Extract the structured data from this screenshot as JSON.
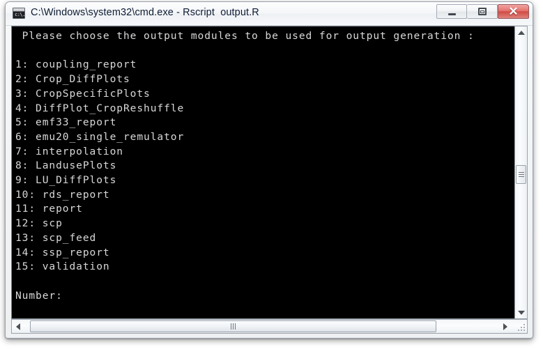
{
  "window": {
    "title": "C:\\Windows\\system32\\cmd.exe - Rscript  output.R",
    "icon": "cmd-console-icon",
    "icon_text": "c:\\.",
    "controls": {
      "minimize_label": "—",
      "maximize_label": "□",
      "close_label": "✕"
    }
  },
  "console": {
    "prompt_line": " Please choose the output modules to be used for output generation :",
    "blank_after_prompt": "",
    "menu": [
      {
        "number": "1:",
        "name": "coupling_report"
      },
      {
        "number": "2:",
        "name": "Crop_DiffPlots"
      },
      {
        "number": "3:",
        "name": "CropSpecificPlots"
      },
      {
        "number": "4:",
        "name": "DiffPlot_CropReshuffle"
      },
      {
        "number": "5:",
        "name": "emf33_report"
      },
      {
        "number": "6:",
        "name": "emu20_single_remulator"
      },
      {
        "number": "7:",
        "name": "interpolation"
      },
      {
        "number": "8:",
        "name": "LandusePlots"
      },
      {
        "number": "9:",
        "name": "LU_DiffPlots"
      },
      {
        "number": "10:",
        "name": "rds_report"
      },
      {
        "number": "11:",
        "name": "report"
      },
      {
        "number": "12:",
        "name": "scp"
      },
      {
        "number": "13:",
        "name": "scp_feed"
      },
      {
        "number": "14:",
        "name": "ssp_report"
      },
      {
        "number": "15:",
        "name": "validation"
      }
    ],
    "input_prompt": "Number:",
    "input_value": "",
    "text_color": "#d8d8d8",
    "background_color": "#000000"
  },
  "scrollbars": {
    "vertical": {
      "up_arrow": "scroll-up",
      "down_arrow": "scroll-down",
      "thumb": "vertical-thumb"
    },
    "horizontal": {
      "left_arrow": "scroll-left",
      "right_arrow": "scroll-right",
      "thumb": "horizontal-thumb"
    }
  }
}
